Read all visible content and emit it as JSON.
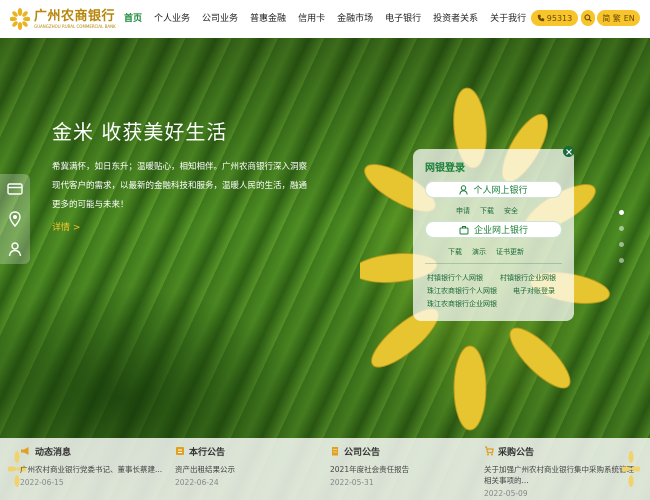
{
  "header": {
    "logo_cn": "广州农商银行",
    "logo_en": "GUANGZHOU RURAL COMMERCIAL BANK",
    "nav": [
      {
        "label": "首页"
      },
      {
        "label": "个人业务"
      },
      {
        "label": "公司业务"
      },
      {
        "label": "普惠金融"
      },
      {
        "label": "信用卡"
      },
      {
        "label": "金融市场"
      },
      {
        "label": "电子银行"
      },
      {
        "label": "投资者关系"
      },
      {
        "label": "关于我行"
      }
    ],
    "phone": "95313",
    "lang_cn": "简 繁",
    "lang_en": "EN"
  },
  "hero": {
    "title": "金米 收获美好生活",
    "desc": "希冀满怀，如日东升；温暖贴心，相知相伴。广州农商银行深入洞察现代客户的需求，以最新的金融科技和服务，温暖人民的生活，融通更多的可能与未来！",
    "more": "详情 >"
  },
  "login": {
    "title": "网银登录",
    "personal": "个人网上银行",
    "personal_links": [
      "申请",
      "下载",
      "安全"
    ],
    "enterprise": "企业网上银行",
    "enterprise_links": [
      "下载",
      "演示",
      "证书更新"
    ],
    "quick": [
      "村镇银行个人网银",
      "村镇银行企业网银",
      "珠江农商银行个人网银",
      "电子对账登录",
      "珠江农商银行企业网银"
    ]
  },
  "news": [
    {
      "title": "动态消息",
      "text": "广州农村商业银行党委书记、董事长蔡建...",
      "date": "2022-06-15"
    },
    {
      "title": "本行公告",
      "text": "资产出租结果公示",
      "date": "2022-06-24"
    },
    {
      "title": "公司公告",
      "text": "2021年度社会责任报告",
      "date": "2022-05-31"
    },
    {
      "title": "采购公告",
      "text": "关于加强广州农村商业银行集中采购系统管理相关事项的...",
      "date": "2022-05-09"
    }
  ],
  "colors": {
    "brand_green": "#1a7f3a",
    "accent_yellow": "#f7c52b"
  }
}
